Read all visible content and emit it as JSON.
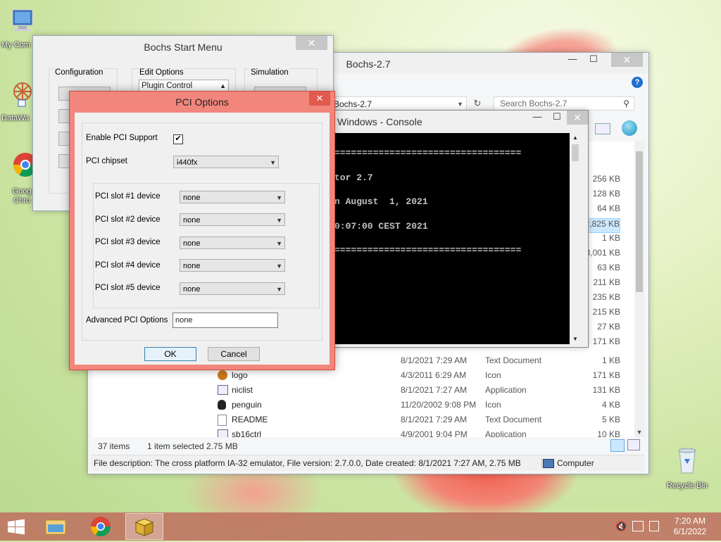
{
  "desktop": {
    "icons": [
      {
        "label": "My Com"
      },
      {
        "label": "DataWa"
      },
      {
        "label": "Goog Chro"
      },
      {
        "label": "Recycle Bin"
      }
    ]
  },
  "start_menu": {
    "title": "Bochs Start Menu",
    "sections": {
      "configuration": "Configuration",
      "edit_options": "Edit Options",
      "simulation": "Simulation"
    },
    "edit_options_selected": "Plugin Control"
  },
  "explorer": {
    "title": "Bochs-2.7",
    "address": "Bochs-2.7",
    "search_placeholder": "Search Bochs-2.7",
    "sizes_above": [
      "256 KB",
      "128 KB",
      "64 KB",
      "2,825 KB",
      "1 KB",
      "3,001 KB",
      "63 KB",
      "211 KB",
      "235 KB",
      "215 KB",
      "27 KB",
      "171 KB"
    ],
    "rows": [
      {
        "name": "",
        "date": "8/1/2021 7:29 AM",
        "type": "Text Document",
        "size": "1 KB"
      },
      {
        "name": "logo",
        "date": "4/3/2011 6:29 AM",
        "type": "Icon",
        "size": "171 KB"
      },
      {
        "name": "niclist",
        "date": "8/1/2021 7:27 AM",
        "type": "Application",
        "size": "131 KB"
      },
      {
        "name": "penguin",
        "date": "11/20/2002 9:08 PM",
        "type": "Icon",
        "size": "4 KB"
      },
      {
        "name": "README",
        "date": "8/1/2021 7:29 AM",
        "type": "Text Document",
        "size": "5 KB"
      },
      {
        "name": "sb16ctrl",
        "date": "4/9/2001 9:04 PM",
        "type": "Application",
        "size": "10 KB"
      }
    ],
    "status": {
      "items": "37 items",
      "selected": "1 item selected  2.75 MB"
    },
    "details_bar": {
      "description": "File description: The cross platform IA-32 emulator, File version: 2.7.0.0, Date created: 8/1/2021 7:27 AM, 2.75 MB",
      "location": "Computer"
    }
  },
  "console": {
    "title": "Windows - Console",
    "lines": [
      "==================================",
      "tor 2.7",
      "n August  1, 2021",
      "0:07:00 CEST 2021",
      "=================================="
    ]
  },
  "pci_dialog": {
    "title": "PCI Options",
    "enable_label": "Enable PCI Support",
    "enable_checked": true,
    "chipset_label": "PCI chipset",
    "chipset_value": "i440fx",
    "slots": [
      {
        "label": "PCI slot #1 device",
        "value": "none"
      },
      {
        "label": "PCI slot #2 device",
        "value": "none"
      },
      {
        "label": "PCI slot #3 device",
        "value": "none"
      },
      {
        "label": "PCI slot #4 device",
        "value": "none"
      },
      {
        "label": "PCI slot #5 device",
        "value": "none"
      }
    ],
    "advanced_label": "Advanced PCI Options",
    "advanced_value": "none",
    "ok_label": "OK",
    "cancel_label": "Cancel"
  },
  "taskbar": {
    "time": "7:20 AM",
    "date": "6/1/2022"
  },
  "colors": {
    "dialog_border": "#f2867c",
    "taskbar": "#be6e5f",
    "console_bg": "#000000"
  }
}
